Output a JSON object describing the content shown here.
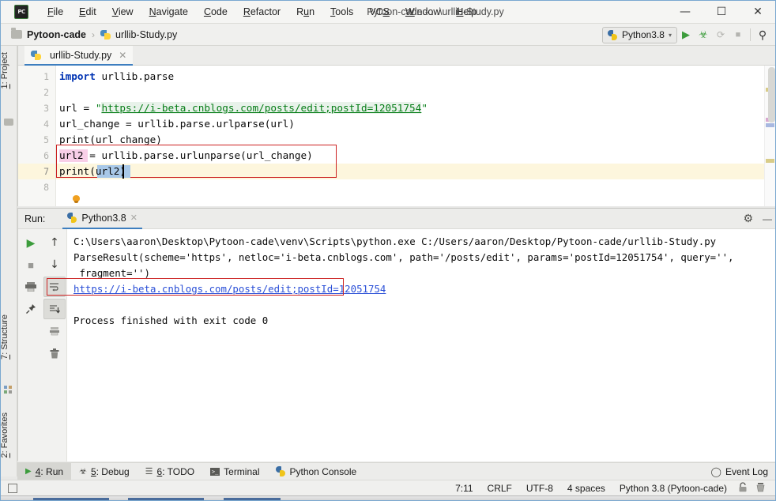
{
  "titlebar": {
    "logo": "pycharm-logo",
    "window_title": "Pytoon-cade - ...\\urllib-Study.py",
    "menu": [
      {
        "label": "File",
        "mnemonic": "F"
      },
      {
        "label": "Edit",
        "mnemonic": "E"
      },
      {
        "label": "View",
        "mnemonic": "V"
      },
      {
        "label": "Navigate",
        "mnemonic": "N"
      },
      {
        "label": "Code",
        "mnemonic": "C"
      },
      {
        "label": "Refactor",
        "mnemonic": "R"
      },
      {
        "label": "Run",
        "mnemonic": "u"
      },
      {
        "label": "Tools",
        "mnemonic": "T"
      },
      {
        "label": "VCS",
        "mnemonic": "S"
      },
      {
        "label": "Window",
        "mnemonic": "W"
      },
      {
        "label": "Help",
        "mnemonic": "H"
      }
    ],
    "minimize": "—",
    "maximize": "☐",
    "close": "✕"
  },
  "navbar": {
    "project_name": "Pytoon-cade",
    "separator": "›",
    "file_name": "urllib-Study.py",
    "run_config": "Python3.8",
    "run_config_caret": "▾",
    "buttons": [
      {
        "name": "run-button",
        "glyph": "▶",
        "color": "#3c9c3c"
      },
      {
        "name": "debug-button",
        "glyph": "☣",
        "color": "#3c9c3c"
      },
      {
        "name": "run-coverage-button",
        "glyph": "⟳",
        "color": "#a8a8a4"
      },
      {
        "name": "stop-button",
        "glyph": "■",
        "color": "#a8a8a4"
      },
      {
        "name": "search-everywhere-icon",
        "glyph": "⌕",
        "color": "#3a3a3a"
      }
    ]
  },
  "left_strip": {
    "tabs": [
      {
        "label": "1: Project",
        "mnemonic": "1",
        "icon": "folder-icon"
      },
      {
        "label": "7: Structure",
        "mnemonic": "7",
        "icon": "structure-icon"
      },
      {
        "label": "2: Favorites",
        "mnemonic": "2",
        "icon": "star-icon"
      }
    ]
  },
  "editor": {
    "tab_label": "urllib-Study.py",
    "tab_close": "✕",
    "line_numbers": [
      "1",
      "2",
      "3",
      "4",
      "5",
      "6",
      "7",
      "8"
    ],
    "current_line": 7,
    "lines": [
      {
        "n": 1,
        "segments": [
          {
            "t": "import",
            "c": "kw"
          },
          {
            "t": " urllib.parse",
            "c": ""
          }
        ]
      },
      {
        "n": 2,
        "segments": [
          {
            "t": "",
            "c": ""
          }
        ]
      },
      {
        "n": 3,
        "segments": [
          {
            "t": "url = ",
            "c": ""
          },
          {
            "t": "\"",
            "c": "str"
          },
          {
            "t": "https://i-beta.cnblogs.com/posts/edit;postId=12051754",
            "c": "urlstr"
          },
          {
            "t": "\"",
            "c": "str"
          }
        ]
      },
      {
        "n": 4,
        "segments": [
          {
            "t": "url_change = urllib.parse.urlparse(url)",
            "c": ""
          }
        ]
      },
      {
        "n": 5,
        "segments": [
          {
            "t": "print(url_change)",
            "c": ""
          }
        ]
      },
      {
        "n": 6,
        "segments": [
          {
            "t": "url2 = urllib.parse.urlunparse(url_change)",
            "c": ""
          }
        ]
      },
      {
        "n": 7,
        "segments": [
          {
            "t": "print(url2)",
            "c": ""
          }
        ]
      },
      {
        "n": 8,
        "segments": [
          {
            "t": "",
            "c": ""
          }
        ]
      }
    ],
    "annotation_box_label": "red-highlight-box-lines-6-7",
    "intention_bulb": "lightbulb-icon"
  },
  "run_window": {
    "label": "Run:",
    "tab_label": "Python3.8",
    "tab_close": "✕",
    "settings_icon": "⚙",
    "minimize_icon": "—",
    "left_tools": [
      {
        "name": "rerun-button",
        "glyph": "▶",
        "color": "#3c9c3c"
      },
      {
        "name": "stop-button",
        "glyph": "■",
        "color": "#8c8c88"
      },
      {
        "name": "print-button",
        "glyph": "☰",
        "color": "#6a6a66"
      },
      {
        "name": "pin-tab-button",
        "glyph": "⚑",
        "color": "#4a4a46"
      },
      {
        "name": "up-stacktrace-button",
        "glyph": "↑",
        "color": "#3a3a36"
      },
      {
        "name": "down-stacktrace-button",
        "glyph": "↓",
        "color": "#3a3a36"
      },
      {
        "name": "soft-wrap-button",
        "glyph": "↵",
        "color": "#4a4a46"
      },
      {
        "name": "scroll-to-end-button",
        "glyph": "↧",
        "color": "#4a4a46"
      },
      {
        "name": "clear-all-button",
        "glyph": "⌧",
        "color": "#6a6a66"
      },
      {
        "name": "trash-button",
        "glyph": "Ὕ1",
        "color": "#6a6a66"
      }
    ],
    "console_lines": [
      {
        "text": "C:\\Users\\aaron\\Desktop\\Pytoon-cade\\venv\\Scripts\\python.exe C:/Users/aaron/Desktop/Pytoon-cade/urllib-Study.py",
        "type": "plain"
      },
      {
        "text": "ParseResult(scheme='https', netloc='i-beta.cnblogs.com', path='/posts/edit', params='postId=12051754', query='',",
        "type": "plain"
      },
      {
        "text": " fragment='')",
        "type": "plain"
      },
      {
        "text": "https://i-beta.cnblogs.com/posts/edit;postId=12051754",
        "type": "link"
      },
      {
        "text": "",
        "type": "plain"
      },
      {
        "text": "Process finished with exit code 0",
        "type": "plain"
      }
    ],
    "annotation_box_label": "red-highlight-box-console-url"
  },
  "bottom_tabs": {
    "tabs": [
      {
        "label": "4: Run",
        "mnemonic": "4",
        "icon": "run-icon",
        "active": true
      },
      {
        "label": "5: Debug",
        "mnemonic": "5",
        "icon": "debug-icon",
        "active": false
      },
      {
        "label": "6: TODO",
        "mnemonic": "6",
        "icon": "todo-icon",
        "active": false
      },
      {
        "label": "Terminal",
        "mnemonic": "",
        "icon": "terminal-icon",
        "active": false
      },
      {
        "label": "Python Console",
        "mnemonic": "",
        "icon": "python-console-icon",
        "active": false
      }
    ],
    "event_log": "Event Log",
    "event_log_icon": "balloon-icon"
  },
  "status_bar": {
    "left_icon": "toggle-toolwindows-icon",
    "items": [
      {
        "name": "caret-position",
        "value": "7:11"
      },
      {
        "name": "line-separator",
        "value": "CRLF"
      },
      {
        "name": "file-encoding",
        "value": "UTF-8"
      },
      {
        "name": "indent-setting",
        "value": "4 spaces"
      },
      {
        "name": "python-interpreter",
        "value": "Python 3.8 (Pytoon-cade)"
      }
    ],
    "lock_icon": "ὑ3",
    "inspection_icon": "inspection-icon"
  },
  "colors": {
    "accent_blue": "#3d7ebf",
    "highlight_red": "#cc2222",
    "keyword_blue": "#0033b3",
    "string_green": "#067d17",
    "link_blue": "#2a4fd7",
    "current_line": "#fdf6dd",
    "run_green": "#3c9c3c"
  }
}
